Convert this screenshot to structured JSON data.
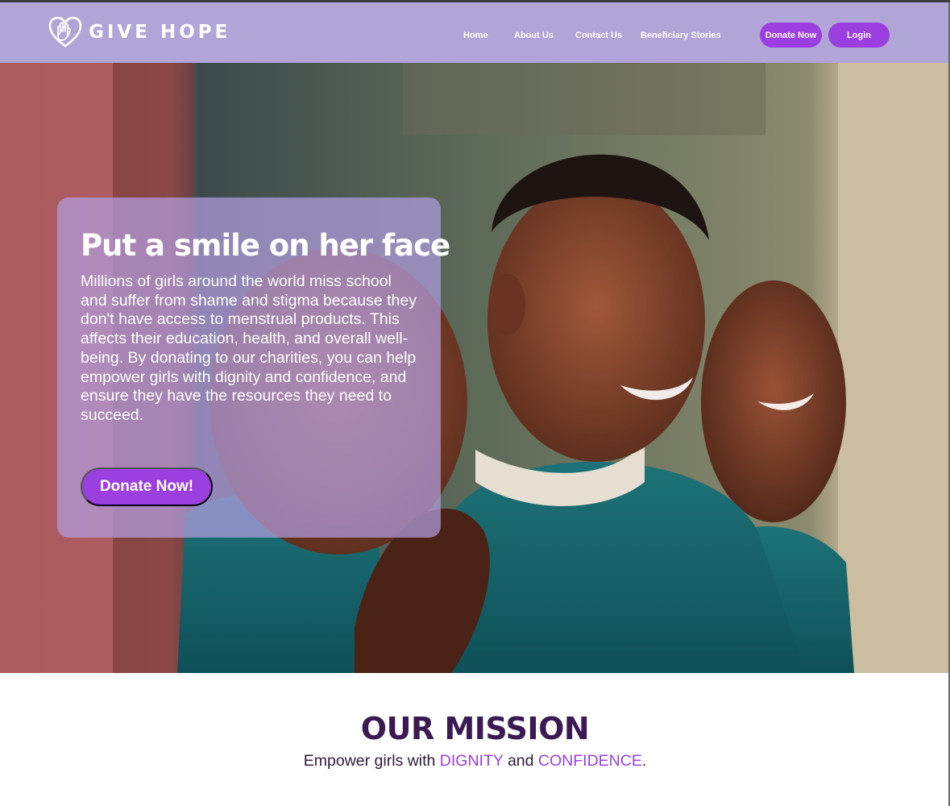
{
  "brand": {
    "name": "GIVE HOPE",
    "logo_icon": "heart-hand-icon"
  },
  "nav": {
    "links": [
      "Home",
      "About Us",
      "Contact Us",
      "Beneficiary Stories"
    ],
    "donate_label": "Donate Now",
    "login_label": "Login"
  },
  "hero": {
    "title": "Put a smile on her face",
    "body": "Millions of girls around the world miss school and suffer from shame and stigma because they don't have access to menstrual products. This affects their education, health, and overall well-being. By donating to our charities, you can help empower girls with dignity and confidence, and ensure they have the resources they need to succeed.",
    "cta_label": "Donate Now!"
  },
  "mission": {
    "title": "OUR MISSION",
    "subtitle_start": "Empower girls with ",
    "accent_1": "DIGNITY",
    "subtitle_mid": " and ",
    "accent_2": "CONFIDENCE",
    "subtitle_end": "."
  },
  "colors": {
    "nav_bg": "#b1a5d8",
    "accent": "#9b3fe0",
    "mission_title": "#3b1a54",
    "card_overlay": "rgba(178,156,222,0.72)"
  }
}
